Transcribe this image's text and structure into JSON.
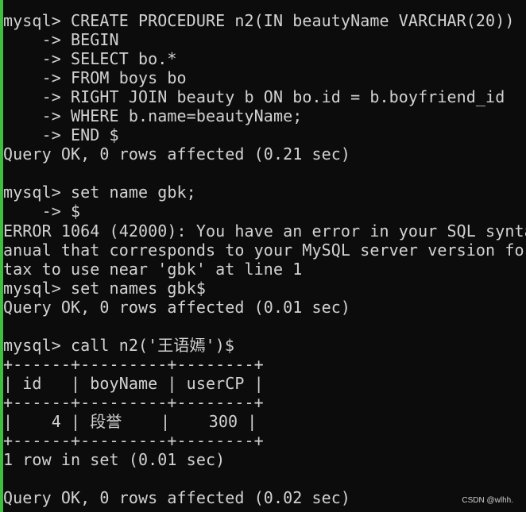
{
  "terminal": {
    "lines": [
      "mysql> CREATE PROCEDURE n2(IN beautyName VARCHAR(20))",
      "    -> BEGIN",
      "    -> SELECT bo.*",
      "    -> FROM boys bo",
      "    -> RIGHT JOIN beauty b ON bo.id = b.boyfriend_id",
      "    -> WHERE b.name=beautyName;",
      "    -> END $",
      "Query OK, 0 rows affected (0.21 sec)",
      "",
      "mysql> set name gbk;",
      "    -> $",
      "ERROR 1064 (42000): You have an error in your SQL synta",
      "anual that corresponds to your MySQL server version for",
      "tax to use near 'gbk' at line 1",
      "mysql> set names gbk$",
      "Query OK, 0 rows affected (0.01 sec)",
      "",
      "mysql> call n2('王语嫣')$",
      "+------+---------+--------+",
      "| id   | boyName | userCP |",
      "+------+---------+--------+",
      "|    4 | 段誉    |    300 |",
      "+------+---------+--------+",
      "1 row in set (0.01 sec)",
      "",
      "Query OK, 0 rows affected (0.02 sec)"
    ]
  },
  "watermark": "CSDN @wlhh."
}
